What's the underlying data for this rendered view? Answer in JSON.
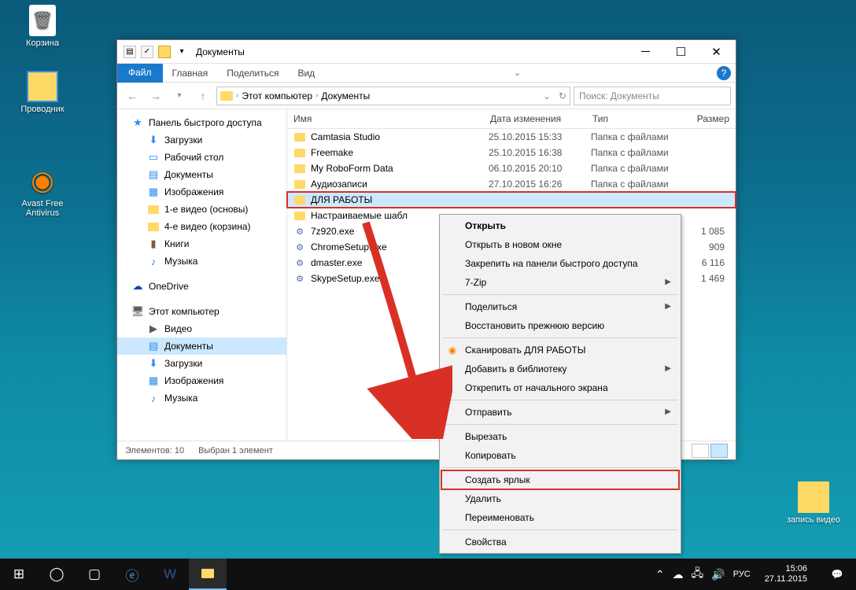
{
  "desktop": {
    "recycle": "Корзина",
    "explorer": "Проводник",
    "avast": "Avast Free Antivirus",
    "folder1": "запись видео"
  },
  "window": {
    "title": "Документы",
    "tabs": {
      "file": "Файл",
      "home": "Главная",
      "share": "Поделиться",
      "view": "Вид"
    },
    "breadcrumb": {
      "pc": "Этот компьютер",
      "docs": "Документы"
    },
    "search_placeholder": "Поиск: Документы",
    "columns": {
      "name": "Имя",
      "date": "Дата изменения",
      "type": "Тип",
      "size": "Размер"
    },
    "nav": {
      "quick": "Панель быстрого доступа",
      "downloads": "Загрузки",
      "desktop": "Рабочий стол",
      "documents": "Документы",
      "images": "Изображения",
      "v1": "1-е видео (основы)",
      "v4": "4-е видео (корзина)",
      "books": "Книги",
      "music": "Музыка",
      "onedrive": "OneDrive",
      "thispc": "Этот компьютер",
      "video": "Видео",
      "documents2": "Документы",
      "downloads2": "Загрузки",
      "images2": "Изображения",
      "music2": "Музыка"
    },
    "files": [
      {
        "name": "Camtasia Studio",
        "date": "25.10.2015 15:33",
        "type": "Папка с файлами",
        "size": "",
        "icon": "fld"
      },
      {
        "name": "Freemake",
        "date": "25.10.2015 16:38",
        "type": "Папка с файлами",
        "size": "",
        "icon": "fld"
      },
      {
        "name": "My RoboForm Data",
        "date": "06.10.2015 20:10",
        "type": "Папка с файлами",
        "size": "",
        "icon": "fld"
      },
      {
        "name": "Аудиозаписи",
        "date": "27.10.2015 16:26",
        "type": "Папка с файлами",
        "size": "",
        "icon": "fld"
      },
      {
        "name": "ДЛЯ РАБОТЫ",
        "date": "",
        "type": "",
        "size": "",
        "icon": "fld",
        "selected": true
      },
      {
        "name": "Настраиваемые шабл",
        "date": "",
        "type": "",
        "size": "",
        "icon": "fld"
      },
      {
        "name": "7z920.exe",
        "date": "",
        "type": "",
        "size": "1 085",
        "icon": "exe"
      },
      {
        "name": "ChromeSetup.exe",
        "date": "",
        "type": "",
        "size": "909",
        "icon": "exe"
      },
      {
        "name": "dmaster.exe",
        "date": "",
        "type": "",
        "size": "6 116",
        "icon": "exe"
      },
      {
        "name": "SkypeSetup.exe",
        "date": "",
        "type": "",
        "size": "1 469",
        "icon": "exe"
      }
    ],
    "status": {
      "count": "Элементов: 10",
      "selected": "Выбран 1 элемент"
    }
  },
  "ctx": {
    "open": "Открыть",
    "openNew": "Открыть в новом окне",
    "pin": "Закрепить на панели быстрого доступа",
    "sevenzip": "7-Zip",
    "share": "Поделиться",
    "restore": "Восстановить прежнюю версию",
    "scan": "Сканировать ДЛЯ РАБОТЫ",
    "library": "Добавить в библиотеку",
    "unpin": "Открепить от начального экрана",
    "send": "Отправить",
    "cut": "Вырезать",
    "copy": "Копировать",
    "shortcut": "Создать ярлык",
    "delete": "Удалить",
    "rename": "Переименовать",
    "props": "Свойства"
  },
  "taskbar": {
    "lang": "РУС",
    "time": "15:06",
    "date": "27.11.2015"
  }
}
